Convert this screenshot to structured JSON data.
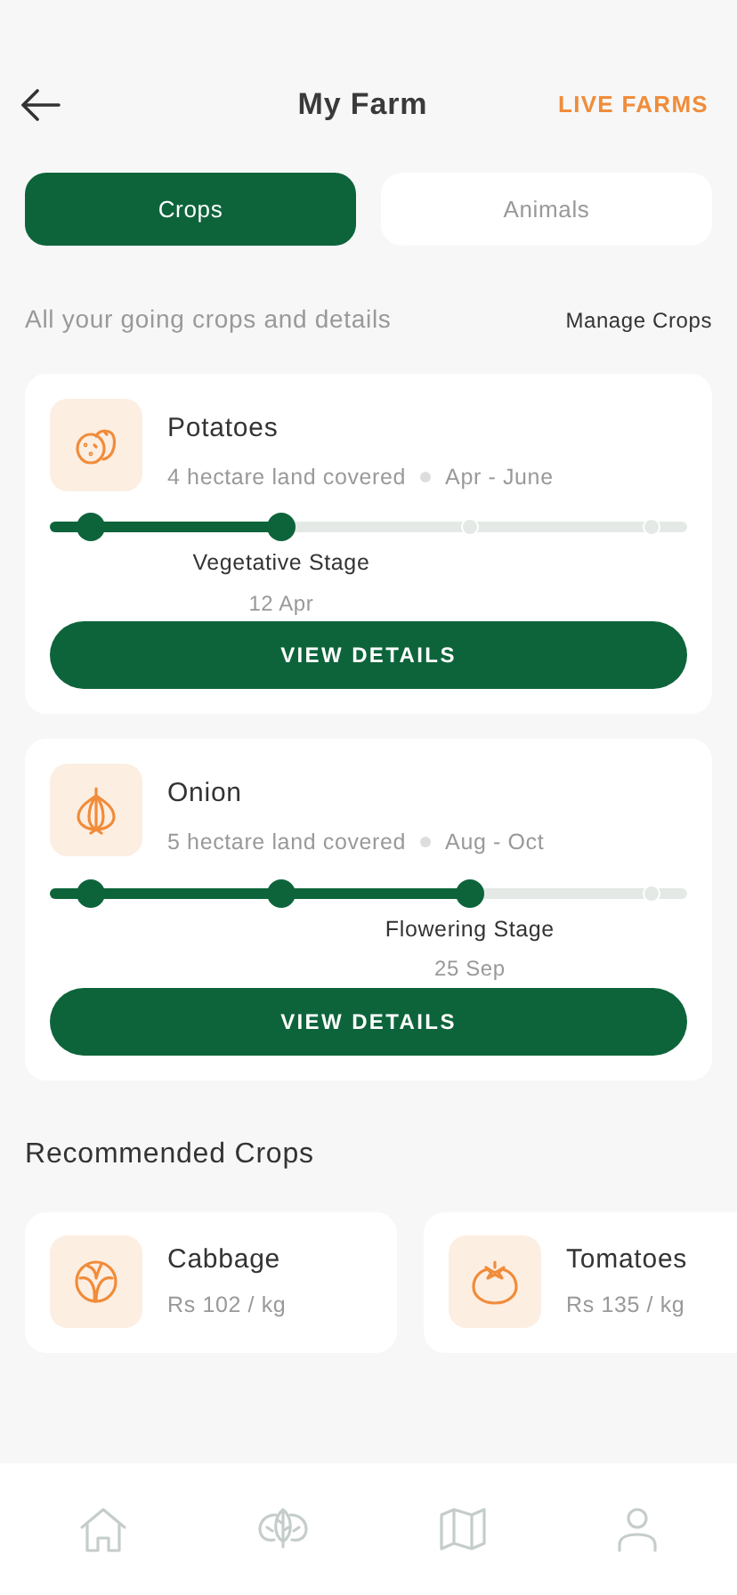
{
  "header": {
    "title": "My Farm",
    "action": "LIVE FARMS"
  },
  "tabs": [
    {
      "label": "Crops",
      "selected": true
    },
    {
      "label": "Animals",
      "selected": false
    }
  ],
  "section": {
    "subtitle": "All your going crops and details",
    "link": "Manage Crops"
  },
  "crops": [
    {
      "name": "Potatoes",
      "area": "4 hectare land covered",
      "season": "Apr - June",
      "button": "VIEW DETAILS",
      "level": 0.363,
      "stages": [
        {
          "reached": true
        },
        {
          "reached": true,
          "label": "Vegetative Stage",
          "date": "12 Apr"
        },
        {
          "reached": false
        },
        {
          "reached": false
        }
      ]
    },
    {
      "name": "Onion",
      "area": "5 hectare land covered",
      "season": "Aug - Oct",
      "button": "VIEW DETAILS",
      "level": 0.659,
      "stages": [
        {
          "reached": true
        },
        {
          "reached": true
        },
        {
          "reached": true,
          "label": "Flowering Stage",
          "date": "25 Sep"
        },
        {
          "reached": false
        }
      ]
    }
  ],
  "recommended": {
    "title": "Recommended Crops",
    "items": [
      {
        "name": "Cabbage",
        "price": "Rs 102 / kg"
      },
      {
        "name": "Tomatoes",
        "price": "Rs 135 / kg"
      }
    ]
  }
}
